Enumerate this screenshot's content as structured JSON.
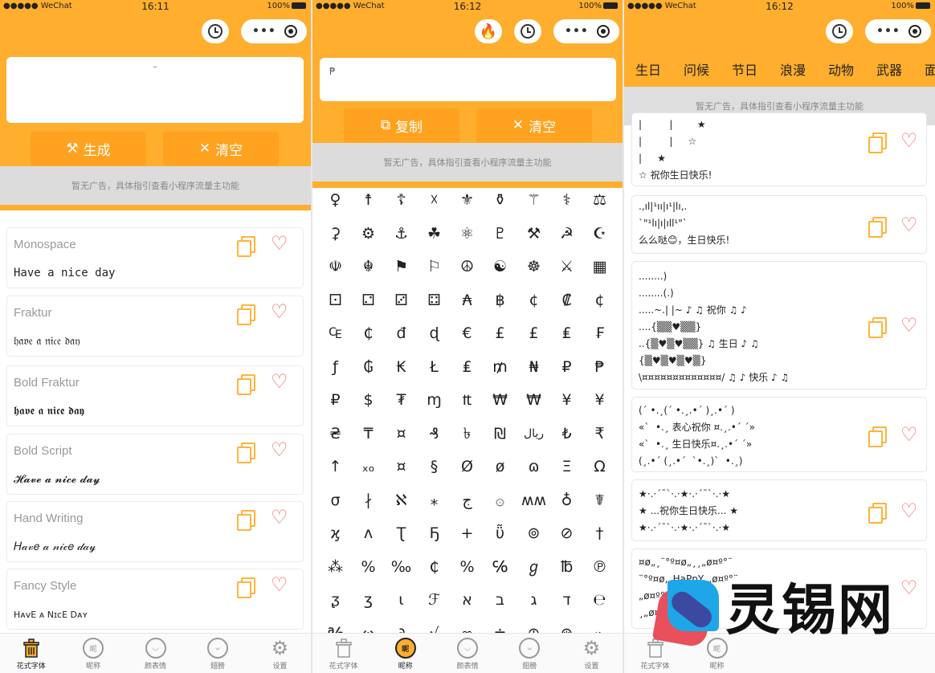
{
  "status": {
    "carrier": "●●●●● WeChat",
    "battery": "100%",
    "time_1": "16:11",
    "time_2": "16:12",
    "time_3": "16:12"
  },
  "panel1": {
    "input_text": "¨",
    "generate_label": "生成",
    "clear_label": "清空",
    "ad_text": "暂无广告，具体指引查看小程序流量主功能",
    "fonts": [
      {
        "name": "Monospace",
        "sample": "Have a nice day"
      },
      {
        "name": "Fraktur",
        "sample": "𝔥𝔞𝔳𝔢 𝔞 𝔫𝔦𝔠𝔢 𝔡𝔞𝔶"
      },
      {
        "name": "Bold Fraktur",
        "sample": "𝖍𝖆𝖛𝖊 𝖆 𝖓𝖎𝖈𝖊 𝖉𝖆𝖞"
      },
      {
        "name": "Bold Script",
        "sample": "𝓗𝓪𝓿𝓮 𝓪 𝓷𝓲𝓬𝓮 𝓭𝓪𝔂"
      },
      {
        "name": "Hand Writing",
        "sample": "𝐻𝒶𝓋𝑒 𝒶 𝓃𝒾𝒸𝑒 𝒹𝒶𝓎"
      },
      {
        "name": "Fancy Style",
        "sample": "HᴀᴠE ᴀ NɪᴄE Dᴀʏ"
      }
    ]
  },
  "panel2": {
    "input_text": "₱",
    "copy_label": "复制",
    "clear_label": "清空",
    "ad_text": "暂无广告，具体指引查看小程序流量主功能",
    "symbols": [
      [
        "♀",
        "☨",
        "☦",
        "☓",
        "⚜",
        "⚱",
        "⚚",
        "⚕",
        "⚖"
      ],
      [
        "⚳",
        "⚙",
        "⚓",
        "☘",
        "⚛",
        "♇",
        "⚒",
        "☭",
        "☪"
      ],
      [
        "☫",
        "☬",
        "⚑",
        "⚐",
        "☮",
        "☯",
        "☸",
        "⚔",
        "▦"
      ],
      [
        "⚀",
        "⚁",
        "⚂",
        "⚃",
        "₳",
        "฿",
        "¢",
        "₡",
        "¢"
      ],
      [
        "₠",
        "₵",
        "đ",
        "ɖ",
        "€",
        "£",
        "£",
        "₤",
        "₣"
      ],
      [
        "ƒ",
        "₲",
        "₭",
        "Ł",
        "₤",
        "₥",
        "₦",
        "₽",
        "₱"
      ],
      [
        "₽",
        "$",
        "₮",
        "ɱ",
        "₶",
        "₩",
        "₩",
        "¥",
        "¥"
      ],
      [
        "₴",
        "₸",
        "¤",
        "₰",
        "৳",
        "₪",
        "ریال",
        "₺",
        "₹"
      ],
      [
        "↑",
        "ₓₒ",
        "¤",
        "§",
        "Ø",
        "ø",
        "ɷ",
        "Ξ",
        "Ω"
      ],
      [
        "σ",
        "∤",
        "ℵ",
        "⁎",
        "ج",
        "۞",
        "ʍʍ",
        "♁",
        "☤"
      ],
      [
        "ϗ",
        "ʌ",
        "Ʈ",
        "Ҕ",
        "+",
        "ῧ",
        "⊚",
        "⊘",
        "†"
      ],
      [
        "⁂",
        "%",
        "‰",
        "₵",
        "%",
        "℅",
        "ℊ",
        "℔",
        "℗"
      ],
      [
        "ᶚ",
        "ʒ",
        "ι",
        "ℱ",
        "א",
        "ב",
        "ג",
        "ד",
        "℮"
      ],
      [
        "℁",
        "↭",
        "∂",
        "√",
        "∞",
        "≐",
        "⊕",
        "⊛",
        "⌁"
      ]
    ]
  },
  "panel3": {
    "categories": [
      "生日",
      "问候",
      "节日",
      "浪漫",
      "动物",
      "武器",
      "面"
    ],
    "ad_text": "暂无广告，具体指引查看小程序流量主功能",
    "cards": [
      {
        "text": "|         |        ★\n|         |     ☆\n|     ★\n☆ 祝你生日快乐!"
      },
      {
        "text": ".,ıl|¹ıı|ı¹|lı,.\n`\"¹lı|ı|ıll¹\"`\n么么哒😊，生日快乐!"
      },
      {
        "text": "........)\n........(.)\n.....~.| |~ ♪ ♫ 祝你 ♫ ♪\n....{▒▒♥▒▒}\n..{▒♥▒♥▒▒} ♫ 生日 ♪ ♫\n{▒♥▒♥▒♥▒}\n\\¤¤¤¤¤¤¤¤¤¤¤¤¤/ ♫ ♪ 快乐 ♪ ♫"
      },
      {
        "text": "(´ •.¸(´ •.¸.•´ )¸.•´ )\n«`  •.¸ 表心祝你 ¤.¸.•´ ´»\n«`  •.¸ 生日快乐¤.¸.•´ ´»\n(¸.•´ (¸.•´  `•.¸)`  •.¸)"
      },
      {
        "text": "★·.·´¯`·.·★·.·´¯`·.·★\n★ ...祝你生日快乐... ★\n★·.·´¯`·.·★·.·´¯`·.·★"
      },
      {
        "text": "¤ø„¸¨°º¤ø„¸¸„ø¤º°¨\n¨°º¤ø„ HaPpY „ø¤º°¨\n„ø¤º°¨    ¨°º¤ø„\n¸„ø¤º°¨"
      }
    ]
  },
  "tabs": [
    "花式字体",
    "昵称",
    "颜表情",
    "翅膀",
    "设置"
  ],
  "watermark": {
    "text": "灵锡网"
  }
}
